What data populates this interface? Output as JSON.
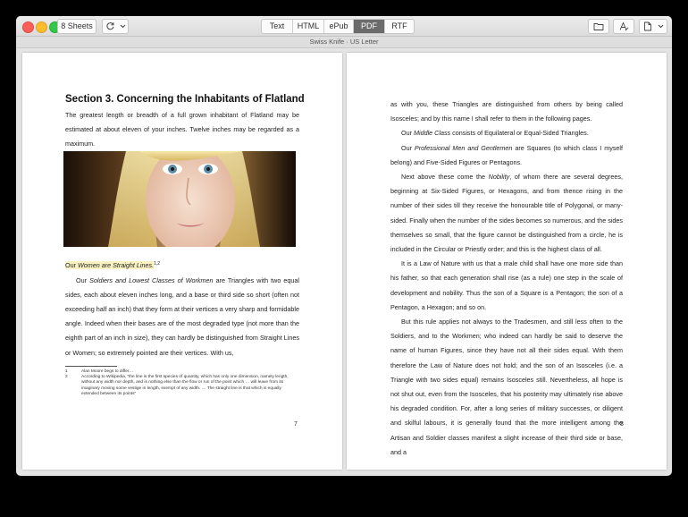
{
  "toolbar": {
    "sheets_label": "8 Sheets",
    "tabs": [
      "Text",
      "HTML",
      "ePub",
      "PDF",
      "RTF"
    ],
    "active_tab": "PDF"
  },
  "subtitle": "Swiss Knife · US Letter",
  "left_page": {
    "heading": "Section 3. Concerning the Inhabitants of Flatland",
    "intro": "The greatest length or breadth of a full grown inhabitant of Flatland may be estimated at about eleven of your inches. Twelve inches may be regarded as a maximum.",
    "highlight_pre": "Our ",
    "highlight_em": "Women are Straight Lines.",
    "highlight_sup": "1,2",
    "para_pre": "Our ",
    "para_em": "Soldiers and Lowest Classes of Workmen",
    "para_post": " are Triangles with two equal sides, each about eleven inches long, and a base or third side so short (often not exceeding half an inch) that they form at their vertices a very sharp and formidable angle. Indeed when their bases are of the most degraded type (not more than the eighth part of an inch in size), they can hardly be distinguished from Straight Lines or Women; so extremely pointed are their vertices. With us,",
    "footnotes": [
      {
        "num": "1",
        "text": "Alan Moore begs to differ…"
      },
      {
        "num": "2",
        "text": "According to Wikipedia, “the line is the first species of quantity, which has only one dimension, namely length, without any width nor depth, and is nothing else than the flow or run of the point which … will leave from its imaginary moving some vestige in length, exempt of any width. … The straight line is that which is equally extended between its points”"
      }
    ],
    "page_number": "7"
  },
  "right_page": {
    "p1": "as with you, these Triangles are distinguished from others by being called Isosceles; and by this name I shall refer to them in the following pages.",
    "p2_pre": "Our ",
    "p2_em": "Middle Class",
    "p2_post": " consists of Equilateral or Equal-Sided Triangles.",
    "p3_pre": "Our ",
    "p3_em": "Professional Men and Gentlemen",
    "p3_post": " are Squares (to which class I myself belong) and Five-Sided Figures or Pentagons.",
    "p4_pre": "Next above these come the ",
    "p4_em": "Nobility",
    "p4_post": ", of whom there are several degrees, beginning at Six-Sided Figures, or Hexagons, and from thence rising in the number of their sides till they receive the honourable title of Polygonal, or many-sided. Finally when the number of the sides becomes so numerous, and the sides themselves so small, that the figure cannot be distinguished from a circle, he is included in the Circular or Priestly order; and this is the highest class of all.",
    "p5": "It is a Law of Nature with us that a male child shall have one more side than his father, so that each generation shall rise (as a rule) one step in the scale of development and nobility. Thus the son of a Square is a Pentagon; the son of a Pentagon, a Hexagon; and so on.",
    "p6": "But this rule applies not always to the Tradesmen, and still less often to the Soldiers, and to the Workmen; who indeed can hardly be said to deserve the name of human Figures, since they have not all their sides equal. With them therefore the Law of Nature does not hold; and the son of an Isosceles (i.e. a Triangle with two sides equal) remains Isosceles still. Nevertheless, all hope is not shut out, even from the Isosceles, that his posterity may ultimately rise above his degraded condition. For, after a long series of military successes, or diligent and skilful labours, it is generally found that the more intelligent among the Artisan and Soldier classes manifest a slight increase of their third side or base, and a",
    "page_number": "8"
  }
}
